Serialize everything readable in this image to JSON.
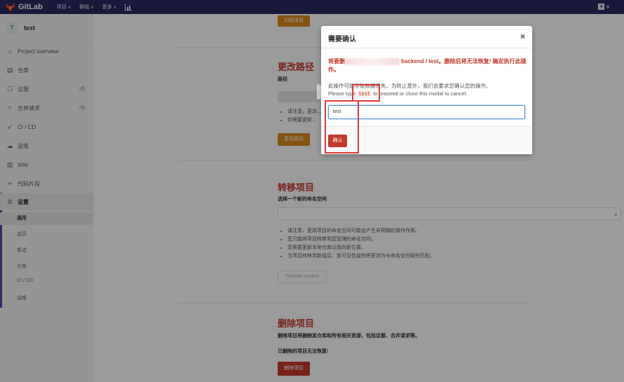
{
  "topbar": {
    "brand": "GitLab",
    "nav": [
      "项目",
      "群组",
      "更多"
    ],
    "chevron": "∨",
    "plus": "+",
    "chevron_small": "∨"
  },
  "sidebar": {
    "project_initial": "T",
    "project_name": "test",
    "items": [
      {
        "icon": "home-icon",
        "glyph": "⌂",
        "label": "Project overview",
        "count": ""
      },
      {
        "icon": "book-icon",
        "glyph": "▤",
        "label": "仓库",
        "count": ""
      },
      {
        "icon": "issues-icon",
        "glyph": "☐",
        "label": "议题",
        "count": "0"
      },
      {
        "icon": "merge-request-icon",
        "glyph": "⑂",
        "label": "合并请求",
        "count": "0"
      },
      {
        "icon": "rocket-icon",
        "glyph": "➶",
        "label": "CI / CD",
        "count": ""
      },
      {
        "icon": "cloud-icon",
        "glyph": "☁",
        "label": "运维",
        "count": ""
      },
      {
        "icon": "wiki-icon",
        "glyph": "▥",
        "label": "Wiki",
        "count": ""
      },
      {
        "icon": "snippets-icon",
        "glyph": "✂",
        "label": "代码片段",
        "count": ""
      },
      {
        "icon": "gear-icon",
        "glyph": "⚙",
        "label": "设置",
        "count": ""
      }
    ],
    "sub_items": [
      "通用",
      "成员",
      "集成",
      "仓库",
      "CI / CD",
      "运维"
    ]
  },
  "main": {
    "top_button": "归档项目",
    "rename": {
      "title": "更改路径",
      "label": "路径",
      "bullets": [
        "请注意，更改...",
        "你需要更新..."
      ],
      "button": "更改路径"
    },
    "transfer": {
      "title": "转移项目",
      "label": "选择一个新的命名空间",
      "bullets": [
        "请注意，更改项目的命名空间可能会产生非预期的操作作用。",
        "您只能将项目转移到您管理的命名空间。",
        "您需要更新本地仓库以指向新位置。",
        "当项目转移到新组后，其可见性级别将更改为与命名空间级别匹配。"
      ],
      "button": "Transfer project"
    },
    "remove": {
      "title": "删除项目",
      "desc": "删除项目将删除其仓库和所有相关资源，包括议题、合并请求等。",
      "warning": "已删除的项目无法恢复!",
      "button": "删除项目"
    }
  },
  "modal": {
    "title": "需要确认",
    "close": "×",
    "warn_prefix": "将要删",
    "warn_suffix": "backend / test。删除后将无法恢复! 确定执行此操作。",
    "info_line1": "此操作可能导致数据丢失。为防止意外，我们会要求您确认您的操作。",
    "info_pre": "Please type ",
    "info_code": "test",
    "info_post": " to proceed or close this modal to cancel.",
    "input_value": "test",
    "confirm_button": "确认"
  },
  "colors": {
    "navbar": "#292961",
    "danger": "#c0392b",
    "warning": "#d6861a",
    "annotation": "#e03a3a"
  }
}
